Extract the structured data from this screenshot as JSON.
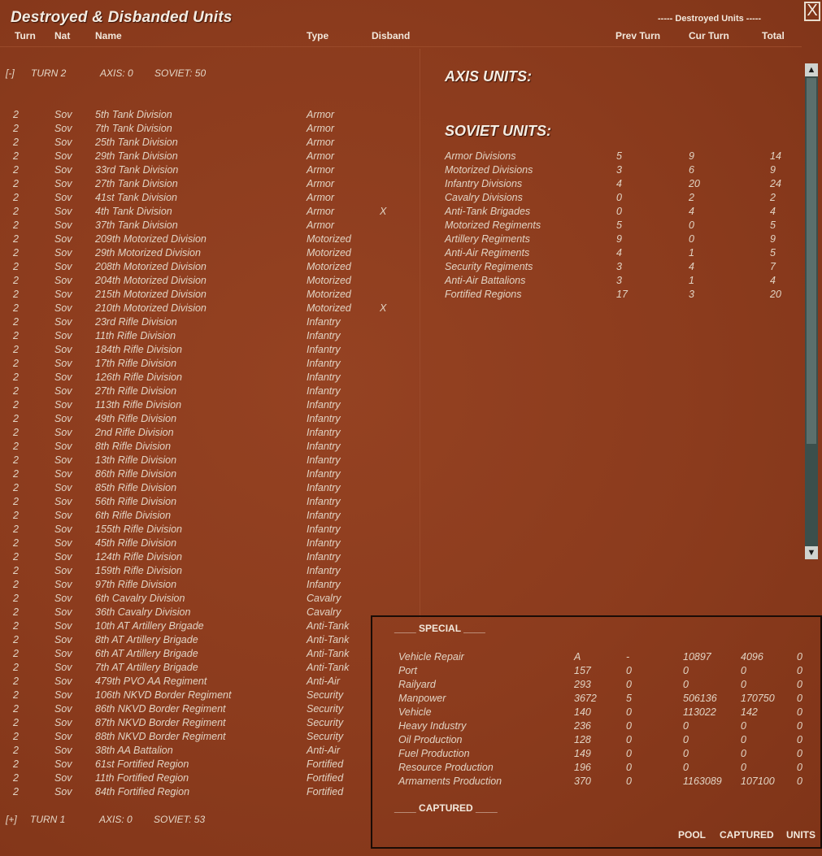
{
  "window": {
    "title": "Destroyed & Disbanded Units",
    "close_label": "X"
  },
  "columns": {
    "turn": "Turn",
    "nat": "Nat",
    "name": "Name",
    "type": "Type",
    "disband": "Disband",
    "destroyed_group": "----- Destroyed Units -----",
    "prev_turn": "Prev Turn",
    "cur_turn": "Cur Turn",
    "total": "Total"
  },
  "turn2": {
    "toggle": "[-]",
    "label": "TURN 2",
    "axis": "AXIS: 0",
    "soviet": "SOVIET: 50"
  },
  "turn1": {
    "toggle": "[+]",
    "label": "TURN 1",
    "axis": "AXIS: 0",
    "soviet": "SOVIET: 53"
  },
  "units": [
    [
      "2",
      "Sov",
      "5th Tank Division",
      "Armor",
      ""
    ],
    [
      "2",
      "Sov",
      "7th Tank Division",
      "Armor",
      ""
    ],
    [
      "2",
      "Sov",
      "25th Tank Division",
      "Armor",
      ""
    ],
    [
      "2",
      "Sov",
      "29th Tank Division",
      "Armor",
      ""
    ],
    [
      "2",
      "Sov",
      "33rd Tank Division",
      "Armor",
      ""
    ],
    [
      "2",
      "Sov",
      "27th Tank Division",
      "Armor",
      ""
    ],
    [
      "2",
      "Sov",
      "41st Tank Division",
      "Armor",
      ""
    ],
    [
      "2",
      "Sov",
      "4th Tank Division",
      "Armor",
      "X"
    ],
    [
      "2",
      "Sov",
      "37th Tank Division",
      "Armor",
      ""
    ],
    [
      "2",
      "Sov",
      "209th Motorized Division",
      "Motorized",
      ""
    ],
    [
      "2",
      "Sov",
      "29th Motorized Division",
      "Motorized",
      ""
    ],
    [
      "2",
      "Sov",
      "208th Motorized Division",
      "Motorized",
      ""
    ],
    [
      "2",
      "Sov",
      "204th Motorized Division",
      "Motorized",
      ""
    ],
    [
      "2",
      "Sov",
      "215th Motorized Division",
      "Motorized",
      ""
    ],
    [
      "2",
      "Sov",
      "210th Motorized Division",
      "Motorized",
      "X"
    ],
    [
      "2",
      "Sov",
      "23rd Rifle Division",
      "Infantry",
      ""
    ],
    [
      "2",
      "Sov",
      "11th Rifle Division",
      "Infantry",
      ""
    ],
    [
      "2",
      "Sov",
      "184th Rifle Division",
      "Infantry",
      ""
    ],
    [
      "2",
      "Sov",
      "17th Rifle Division",
      "Infantry",
      ""
    ],
    [
      "2",
      "Sov",
      "126th Rifle Division",
      "Infantry",
      ""
    ],
    [
      "2",
      "Sov",
      "27th Rifle Division",
      "Infantry",
      ""
    ],
    [
      "2",
      "Sov",
      "113th Rifle Division",
      "Infantry",
      ""
    ],
    [
      "2",
      "Sov",
      "49th Rifle Division",
      "Infantry",
      ""
    ],
    [
      "2",
      "Sov",
      "2nd Rifle Division",
      "Infantry",
      ""
    ],
    [
      "2",
      "Sov",
      "8th Rifle Division",
      "Infantry",
      ""
    ],
    [
      "2",
      "Sov",
      "13th Rifle Division",
      "Infantry",
      ""
    ],
    [
      "2",
      "Sov",
      "86th Rifle Division",
      "Infantry",
      ""
    ],
    [
      "2",
      "Sov",
      "85th Rifle Division",
      "Infantry",
      ""
    ],
    [
      "2",
      "Sov",
      "56th Rifle Division",
      "Infantry",
      ""
    ],
    [
      "2",
      "Sov",
      "6th Rifle Division",
      "Infantry",
      ""
    ],
    [
      "2",
      "Sov",
      "155th Rifle Division",
      "Infantry",
      ""
    ],
    [
      "2",
      "Sov",
      "45th Rifle Division",
      "Infantry",
      ""
    ],
    [
      "2",
      "Sov",
      "124th Rifle Division",
      "Infantry",
      ""
    ],
    [
      "2",
      "Sov",
      "159th Rifle Division",
      "Infantry",
      ""
    ],
    [
      "2",
      "Sov",
      "97th Rifle Division",
      "Infantry",
      ""
    ],
    [
      "2",
      "Sov",
      "6th Cavalry Division",
      "Cavalry",
      ""
    ],
    [
      "2",
      "Sov",
      "36th Cavalry Division",
      "Cavalry",
      ""
    ],
    [
      "2",
      "Sov",
      "10th AT Artillery Brigade",
      "Anti-Tank",
      ""
    ],
    [
      "2",
      "Sov",
      "8th AT Artillery Brigade",
      "Anti-Tank",
      ""
    ],
    [
      "2",
      "Sov",
      "6th AT Artillery Brigade",
      "Anti-Tank",
      ""
    ],
    [
      "2",
      "Sov",
      "7th AT Artillery Brigade",
      "Anti-Tank",
      ""
    ],
    [
      "2",
      "Sov",
      "479th PVO AA Regiment",
      "Anti-Air",
      ""
    ],
    [
      "2",
      "Sov",
      "106th NKVD Border Regiment",
      "Security",
      ""
    ],
    [
      "2",
      "Sov",
      "86th NKVD Border Regiment",
      "Security",
      ""
    ],
    [
      "2",
      "Sov",
      "87th NKVD Border Regiment",
      "Security",
      ""
    ],
    [
      "2",
      "Sov",
      "88th NKVD Border Regiment",
      "Security",
      ""
    ],
    [
      "2",
      "Sov",
      "38th AA Battalion",
      "Anti-Air",
      ""
    ],
    [
      "2",
      "Sov",
      "61st Fortified Region",
      "Fortified",
      ""
    ],
    [
      "2",
      "Sov",
      "11th Fortified Region",
      "Fortified",
      ""
    ],
    [
      "2",
      "Sov",
      "84th Fortified Region",
      "Fortified",
      ""
    ]
  ],
  "summary": {
    "axis_title": "AXIS UNITS:",
    "soviet_title": "SOVIET UNITS:",
    "soviet_rows": [
      [
        "Armor Divisions",
        "5",
        "9",
        "14"
      ],
      [
        "Motorized Divisions",
        "3",
        "6",
        "9"
      ],
      [
        "Infantry Divisions",
        "4",
        "20",
        "24"
      ],
      [
        "Cavalry Divisions",
        "0",
        "2",
        "2"
      ],
      [
        "Anti-Tank Brigades",
        "0",
        "4",
        "4"
      ],
      [
        "Motorized Regiments",
        "5",
        "0",
        "5"
      ],
      [
        "Artillery Regiments",
        "9",
        "0",
        "9"
      ],
      [
        "Anti-Air Regiments",
        "4",
        "1",
        "5"
      ],
      [
        "Security Regiments",
        "3",
        "4",
        "7"
      ],
      [
        "Anti-Air Battalions",
        "3",
        "1",
        "4"
      ],
      [
        "Fortified Regions",
        "17",
        "3",
        "20"
      ]
    ]
  },
  "special": {
    "heading": "____ SPECIAL ____",
    "captured_heading": "____ CAPTURED ____",
    "rows": [
      [
        "Vehicle Repair",
        "A",
        "-",
        "10897",
        "4096",
        "0"
      ],
      [
        "Port",
        "157",
        "0",
        "0",
        "0",
        "0"
      ],
      [
        "Railyard",
        "293",
        "0",
        "0",
        "0",
        "0"
      ],
      [
        "Manpower",
        "3672",
        "5",
        "506136",
        "170750",
        "0"
      ],
      [
        "Vehicle",
        "140",
        "0",
        "113022",
        "142",
        "0"
      ],
      [
        "Heavy Industry",
        "236",
        "0",
        "0",
        "0",
        "0"
      ],
      [
        "Oil Production",
        "128",
        "0",
        "0",
        "0",
        "0"
      ],
      [
        "Fuel Production",
        "149",
        "0",
        "0",
        "0",
        "0"
      ],
      [
        "Resource Production",
        "196",
        "0",
        "0",
        "0",
        "0"
      ],
      [
        "Armaments Production",
        "370",
        "0",
        "1163089",
        "107100",
        "0"
      ]
    ],
    "footer": {
      "pool": "POOL",
      "captured": "CAPTURED",
      "units": "UNITS"
    }
  },
  "scrollbar": {
    "up": "▲",
    "down": "▼"
  }
}
